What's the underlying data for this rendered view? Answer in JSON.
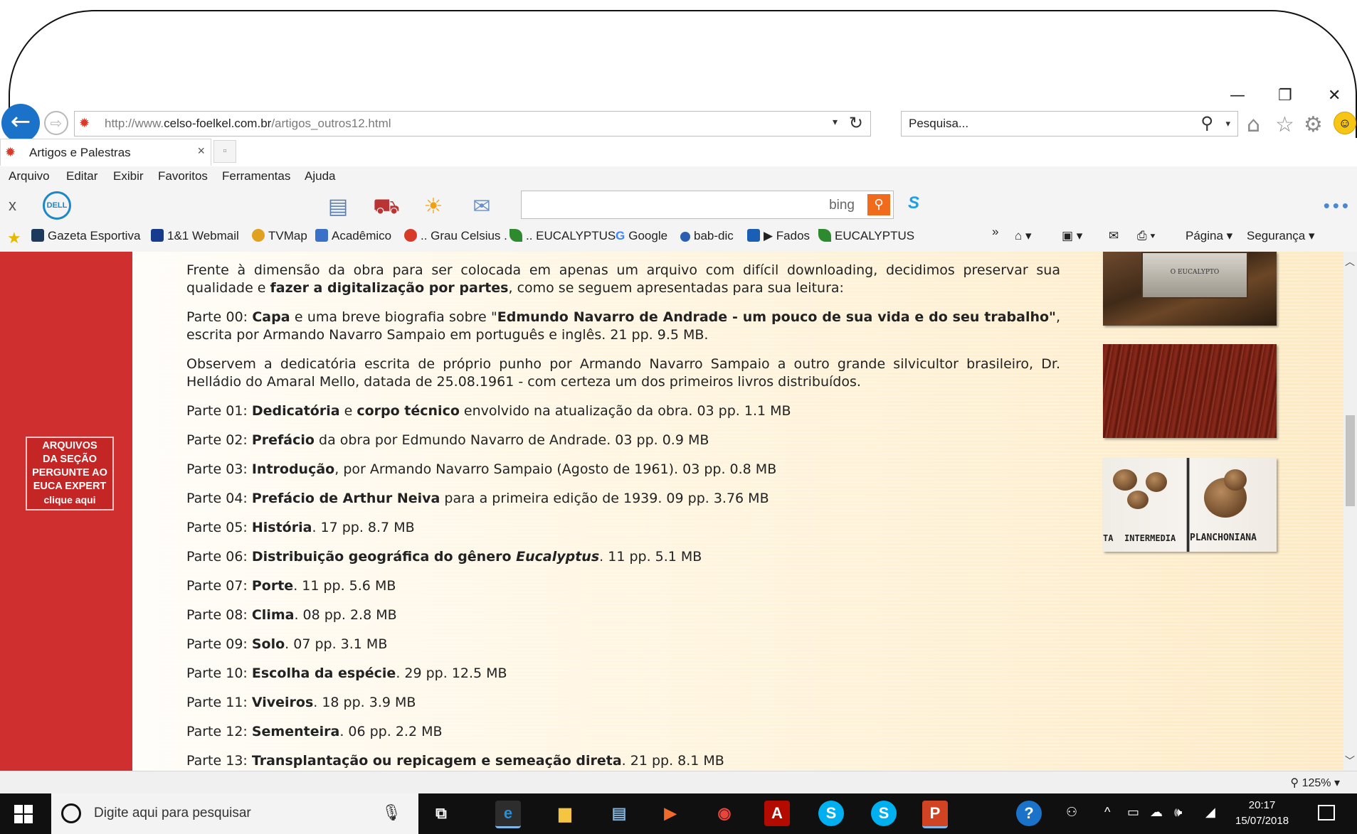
{
  "window": {
    "minimize": "—",
    "restore": "❐",
    "close": "✕"
  },
  "nav": {
    "back_icon": "←",
    "forward_icon": "⇨",
    "url_prefix": "http://www.",
    "url_domain": "celso-foelkel.com.br",
    "url_path": "/artigos_outros12.html",
    "search_placeholder": "Pesquisa..."
  },
  "tab": {
    "title": "Artigos e Palestras",
    "close": "×"
  },
  "menu": [
    "Arquivo",
    "Editar",
    "Exibir",
    "Favoritos",
    "Ferramentas",
    "Ajuda"
  ],
  "toolbar": {
    "close": "x",
    "dell": "DELL",
    "bing_brand": "bing"
  },
  "favorites": [
    {
      "label": "Gazeta Esportiva",
      "color": "#1b3a5c"
    },
    {
      "label": "1&1 Webmail",
      "color": "#173c8c"
    },
    {
      "label": "TVMap",
      "color": "#e0a020"
    },
    {
      "label": "Acadêmico",
      "color": "#3b70c8"
    },
    {
      "label": ".. Grau Celsius .",
      "color": "#d83a2a"
    },
    {
      "label": ".. EUCALYPTUS",
      "color": "#2e8a2e"
    },
    {
      "label": "Google",
      "color": "#4285f4"
    },
    {
      "label": "bab-dic",
      "color": "#2a5fb0"
    },
    {
      "label": "▶ Fados",
      "color": "#1a5fb4"
    },
    {
      "label": "EUCALYPTUS",
      "color": "#2e8a2e"
    }
  ],
  "commandbar": {
    "chevron": "»",
    "pagina": "Página ▾",
    "seguranca": "Segurança ▾"
  },
  "sidebar_badge": {
    "lines": [
      "ARQUIVOS",
      "DA SEÇÃO",
      "PERGUNTE AO",
      "EUCA EXPERT"
    ],
    "link": "clique aqui"
  },
  "photos": {
    "p3_left": "INTERMEDIA",
    "p3_right": "PLANCHONIANA",
    "p3_edge": "TA",
    "p1_label": "O EUCALYPTO"
  },
  "content": {
    "intro_a": "Frente à dimensão da obra para ser colocada em apenas um arquivo com difícil downloading, decidimos preservar sua qualidade e ",
    "intro_b": "fazer a digitalização por partes",
    "intro_c": ", como se seguem apresentadas para sua leitura:",
    "p00_a": "Parte 00: ",
    "p00_b": "Capa",
    "p00_c": " e uma breve biografia sobre \"",
    "p00_d": "Edmundo Navarro de Andrade - um pouco de sua vida e do seu trabalho\"",
    "p00_e": ", escrita por Armando Navarro Sampaio em português e inglês. 21 pp. 9.5 MB.",
    "dedic": "Observem a dedicatória escrita de próprio punho por Armando Navarro Sampaio a outro grande silvicultor brasileiro, Dr. Helládio do Amaral Mello, datada de 25.08.1961 - com certeza um dos primeiros livros distribuídos.",
    "parts": [
      {
        "n": "Parte 01: ",
        "b": "Dedicatória",
        "m": " e ",
        "b2": "corpo técnico",
        "r": " envolvido na atualização da obra. 03 pp. 1.1 MB"
      },
      {
        "n": "Parte 02: ",
        "b": "Prefácio",
        "r": " da obra por Edmundo Navarro de Andrade. 03 pp.  0.9 MB"
      },
      {
        "n": "Parte 03: ",
        "b": "Introdução",
        "r": ", por Armando Navarro Sampaio (Agosto de 1961). 03 pp. 0.8 MB"
      },
      {
        "n": "Parte 04: ",
        "b": "Prefácio de Arthur Neiva",
        "r": " para a primeira edição de 1939. 09 pp.  3.76 MB"
      },
      {
        "n": "Parte 05: ",
        "b": "História",
        "r": ". 17 pp.  8.7 MB"
      },
      {
        "n": "Parte 06: ",
        "b": "Distribuição geográfica do gênero ",
        "bi": "Eucalyptus",
        "r": ". 11 pp.  5.1 MB"
      },
      {
        "n": "Parte 07: ",
        "b": "Porte",
        "r": ". 11 pp.  5.6 MB"
      },
      {
        "n": "Parte 08: ",
        "b": "Clima",
        "r": ". 08 pp.  2.8 MB"
      },
      {
        "n": "Parte 09: ",
        "b": "Solo",
        "r": ". 07 pp.  3.1 MB"
      },
      {
        "n": "Parte 10: ",
        "b": "Escolha da espécie",
        "r": ". 29 pp.  12.5 MB"
      },
      {
        "n": "Parte 11: ",
        "b": "Viveiros",
        "r": ". 18 pp.  3.9 MB"
      },
      {
        "n": "Parte 12: ",
        "b": "Sementeira",
        "r": ". 06 pp.  2.2 MB"
      },
      {
        "n": "Parte 13: ",
        "b": "Transplantação ou repicagem e semeação direta",
        "r": ". 21 pp.  8.1 MB"
      }
    ]
  },
  "status": {
    "zoom": "125%"
  },
  "taskbar": {
    "search_placeholder": "Digite aqui para pesquisar",
    "time": "20:17",
    "date": "15/07/2018"
  }
}
